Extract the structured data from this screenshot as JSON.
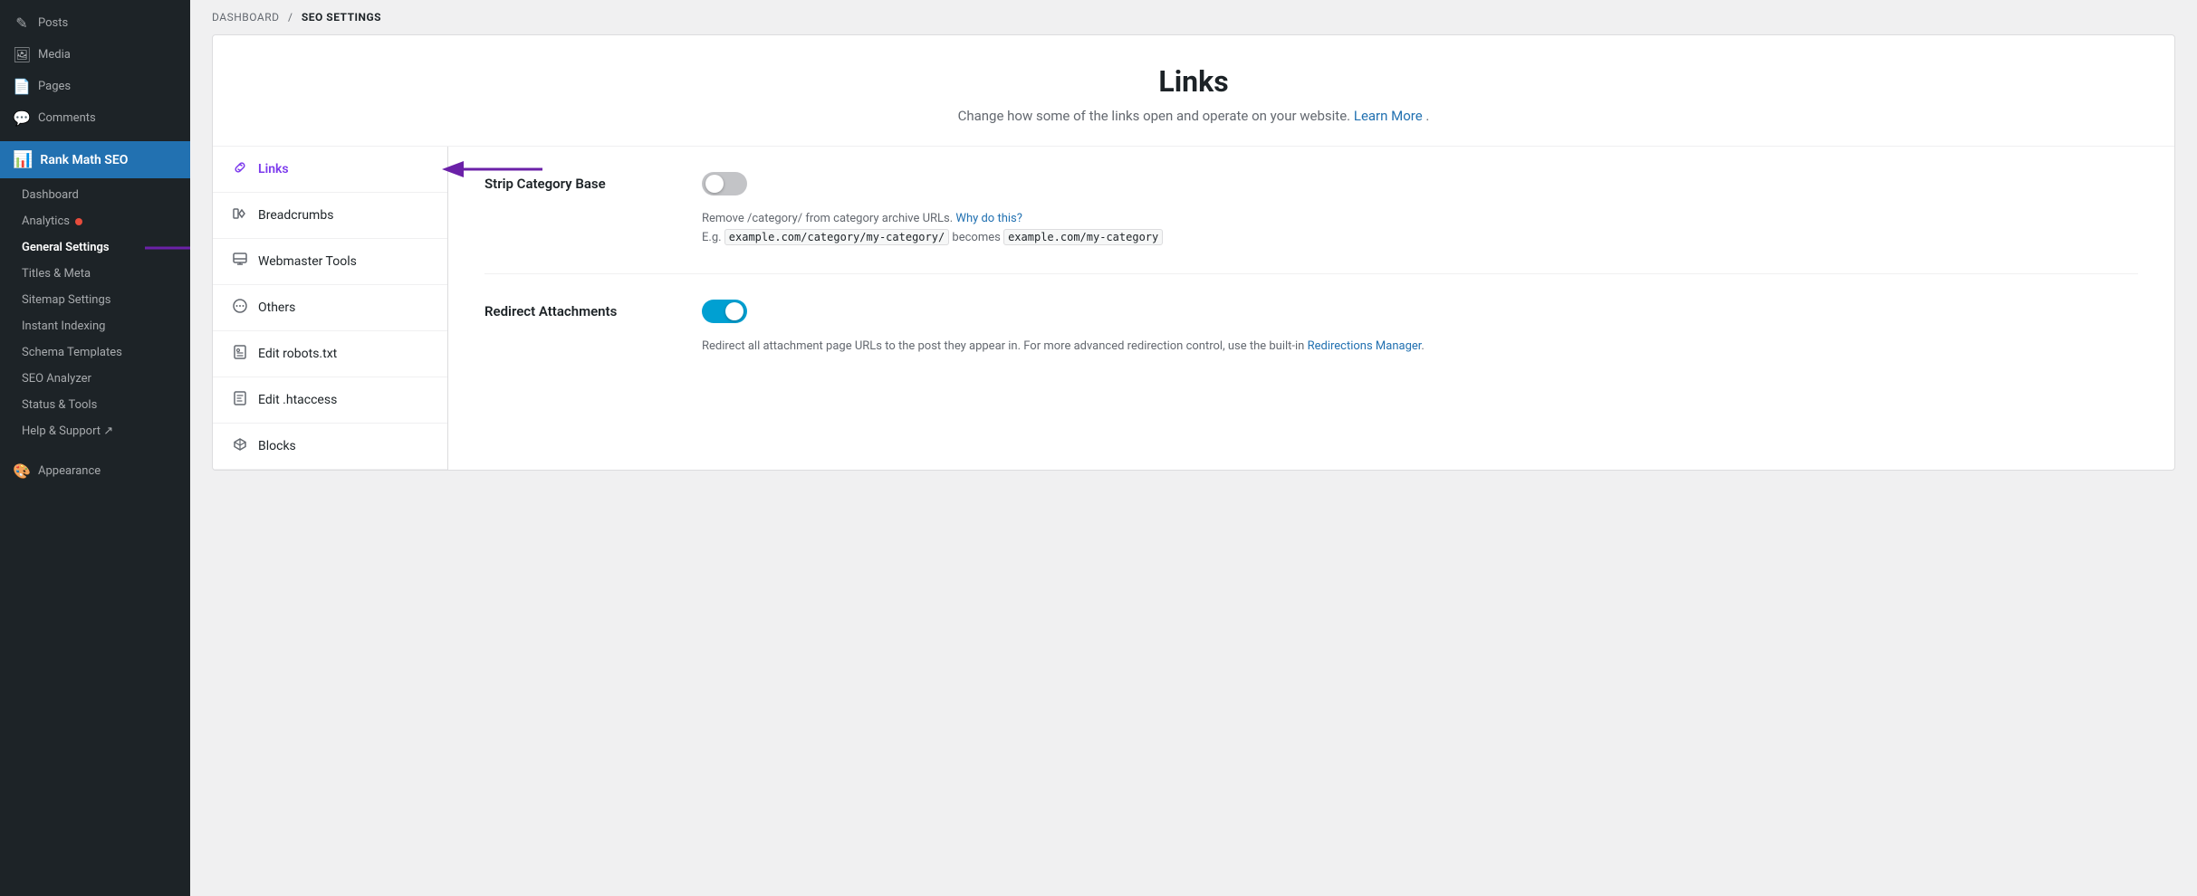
{
  "sidebar": {
    "items": [
      {
        "id": "posts",
        "label": "Posts",
        "icon": "✎"
      },
      {
        "id": "media",
        "label": "Media",
        "icon": "🖼"
      },
      {
        "id": "pages",
        "label": "Pages",
        "icon": "📄"
      },
      {
        "id": "comments",
        "label": "Comments",
        "icon": "💬"
      }
    ],
    "rank_math": {
      "label": "Rank Math SEO",
      "icon": "📊"
    },
    "rank_math_submenu": [
      {
        "id": "dashboard",
        "label": "Dashboard",
        "active": false
      },
      {
        "id": "analytics",
        "label": "Analytics",
        "active": false,
        "dot": true
      },
      {
        "id": "general-settings",
        "label": "General Settings",
        "active": true
      },
      {
        "id": "titles-meta",
        "label": "Titles & Meta",
        "active": false
      },
      {
        "id": "sitemap-settings",
        "label": "Sitemap Settings",
        "active": false
      },
      {
        "id": "instant-indexing",
        "label": "Instant Indexing",
        "active": false
      },
      {
        "id": "schema-templates",
        "label": "Schema Templates",
        "active": false
      },
      {
        "id": "seo-analyzer",
        "label": "SEO Analyzer",
        "active": false
      },
      {
        "id": "status-tools",
        "label": "Status & Tools",
        "active": false
      },
      {
        "id": "help-support",
        "label": "Help & Support ↗",
        "active": false
      }
    ],
    "bottom_items": [
      {
        "id": "appearance",
        "label": "Appearance",
        "icon": "🎨"
      }
    ]
  },
  "breadcrumb": {
    "dashboard_label": "DASHBOARD",
    "separator": "/",
    "current_label": "SEO SETTINGS"
  },
  "page_header": {
    "title": "Links",
    "description": "Change how some of the links open and operate on your website.",
    "learn_more": "Learn More",
    "period": "."
  },
  "settings_nav": [
    {
      "id": "links",
      "label": "Links",
      "icon": "⚙",
      "active": true
    },
    {
      "id": "breadcrumbs",
      "label": "Breadcrumbs",
      "icon": "🚩"
    },
    {
      "id": "webmaster-tools",
      "label": "Webmaster Tools",
      "icon": "🧰"
    },
    {
      "id": "others",
      "label": "Others",
      "icon": "⊙"
    },
    {
      "id": "edit-robots",
      "label": "Edit robots.txt",
      "icon": "📁"
    },
    {
      "id": "edit-htaccess",
      "label": "Edit .htaccess",
      "icon": "📄"
    },
    {
      "id": "blocks",
      "label": "Blocks",
      "icon": "◇"
    }
  ],
  "settings": [
    {
      "id": "strip-category-base",
      "label": "Strip Category Base",
      "toggle_state": "off",
      "description_parts": [
        {
          "type": "text",
          "value": "Remove /category/ from category archive URLs. "
        },
        {
          "type": "link",
          "value": "Why do this?",
          "href": "#"
        },
        {
          "type": "newline"
        },
        {
          "type": "text",
          "value": "E.g. "
        },
        {
          "type": "code",
          "value": "example.com/category/my-category/"
        },
        {
          "type": "text",
          "value": " becomes "
        },
        {
          "type": "code",
          "value": "example.com/my-category"
        }
      ]
    },
    {
      "id": "redirect-attachments",
      "label": "Redirect Attachments",
      "toggle_state": "on",
      "description_parts": [
        {
          "type": "text",
          "value": "Redirect all attachment page URLs to the post they appear in. For more advanced redirection control, use the built-in "
        },
        {
          "type": "link",
          "value": "Redirections Manager",
          "href": "#"
        },
        {
          "type": "text",
          "value": "."
        }
      ]
    }
  ]
}
